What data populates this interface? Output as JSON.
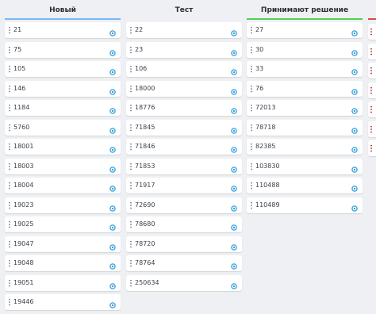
{
  "colors": {
    "column_new_accent": "#7ab8f5",
    "column_decision_accent": "#4fd14f",
    "column_partial_accent": "#e04848",
    "gear_icon": "#2d9bdc"
  },
  "columns": [
    {
      "title": "Новый",
      "cards": [
        "21",
        "75",
        "105",
        "146",
        "1184",
        "5760",
        "18001",
        "18003",
        "18004",
        "19023",
        "19025",
        "19047",
        "19048",
        "19051",
        "19446"
      ]
    },
    {
      "title": "Тест",
      "cards": [
        "22",
        "23",
        "106",
        "18000",
        "18776",
        "71845",
        "71846",
        "71853",
        "71917",
        "72690",
        "78680",
        "78720",
        "78764",
        "250634"
      ]
    },
    {
      "title": "Принимают решение",
      "cards": [
        "27",
        "30",
        "33",
        "76",
        "72013",
        "78718",
        "82385",
        "103830",
        "110488",
        "110489"
      ]
    }
  ]
}
